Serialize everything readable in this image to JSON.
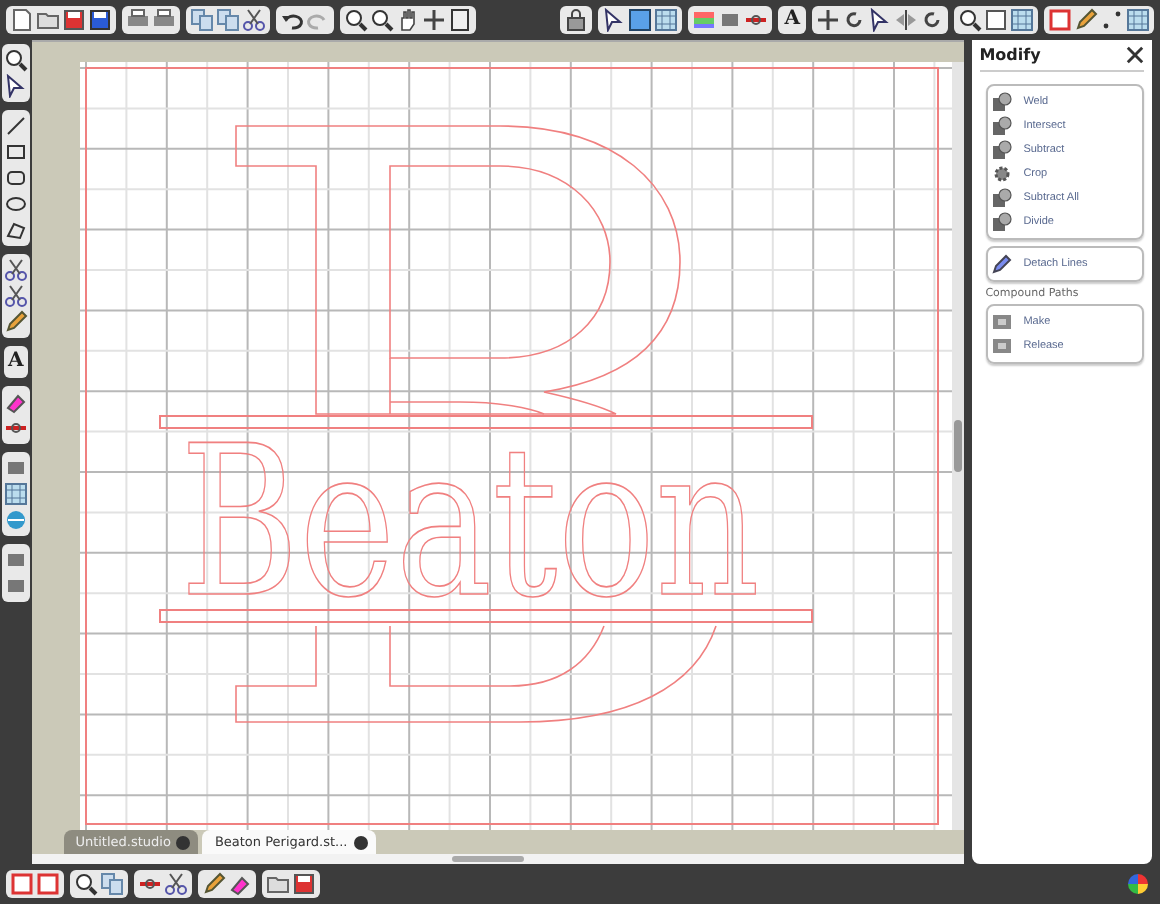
{
  "toolbar": {
    "text_tool_glyph": "A"
  },
  "left_tools": {
    "text_tool_glyph": "A"
  },
  "canvas": {
    "name_text": "Beaton"
  },
  "tabs": [
    {
      "label": "Untitled.studio",
      "selected": false
    },
    {
      "label": "Beaton Perigard.st...",
      "selected": true
    }
  ],
  "panel": {
    "title": "Modify",
    "groups": [
      {
        "items": [
          {
            "label": "Weld"
          },
          {
            "label": "Intersect"
          },
          {
            "label": "Subtract"
          },
          {
            "label": "Crop"
          },
          {
            "label": "Subtract All"
          },
          {
            "label": "Divide"
          }
        ]
      },
      {
        "items": [
          {
            "label": "Detach Lines"
          }
        ]
      },
      {
        "heading": "Compound Paths",
        "items": [
          {
            "label": "Make"
          },
          {
            "label": "Release"
          }
        ]
      }
    ]
  }
}
